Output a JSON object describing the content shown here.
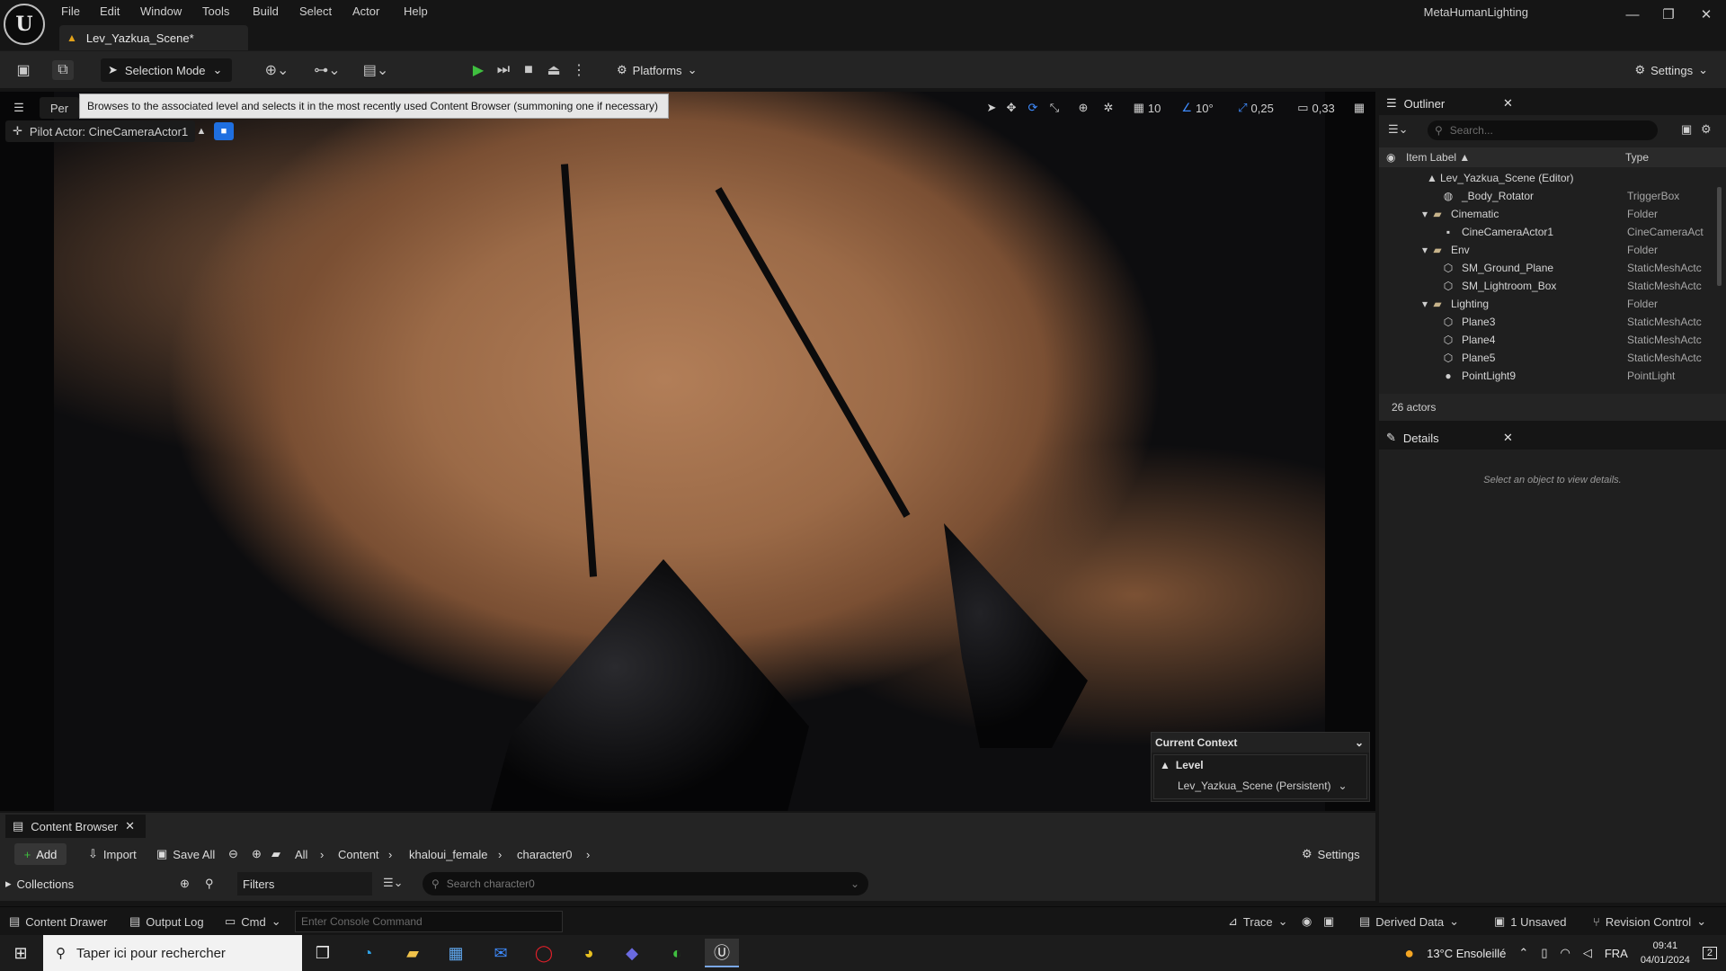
{
  "title_bar": {
    "logo": "U",
    "menu": [
      "File",
      "Edit",
      "Window",
      "Tools",
      "Build",
      "Select",
      "Actor",
      "Help"
    ],
    "app_title": "MetaHumanLighting",
    "window_buttons": {
      "minimize": "—",
      "restore": "❐",
      "close": "✕"
    }
  },
  "document_tab": {
    "label": "Lev_Yazkua_Scene*"
  },
  "toolbar": {
    "selection_mode": "Selection Mode",
    "platforms": "Platforms",
    "settings": "Settings"
  },
  "viewport": {
    "menu_short": "Per",
    "tooltip": "Browses to the associated level and selects it in the most recently used Content Browser (summoning one if necessary)",
    "pilot_actor": "Pilot Actor: CineCameraActor1",
    "grid_snap": "10",
    "rotation_snap": "10°",
    "scale_snap": "0,25",
    "camera_speed": "0,33",
    "context": {
      "header": "Current Context",
      "level_label": "Level",
      "level_value": "Lev_Yazkua_Scene (Persistent)"
    }
  },
  "outliner": {
    "tab": "Outliner",
    "search_placeholder": "Search...",
    "col_label": "Item Label ▲",
    "col_type": "Type",
    "rows": [
      {
        "label": "Lev_Yazkua_Scene (Editor)",
        "type": ""
      },
      {
        "label": "_Body_Rotator",
        "type": "TriggerBox"
      },
      {
        "label": "Cinematic",
        "type": "Folder"
      },
      {
        "label": "CineCameraActor1",
        "type": "CineCameraAct"
      },
      {
        "label": "Env",
        "type": "Folder"
      },
      {
        "label": "SM_Ground_Plane",
        "type": "StaticMeshActc"
      },
      {
        "label": "SM_Lightroom_Box",
        "type": "StaticMeshActc"
      },
      {
        "label": "Lighting",
        "type": "Folder"
      },
      {
        "label": "Plane3",
        "type": "StaticMeshActc"
      },
      {
        "label": "Plane4",
        "type": "StaticMeshActc"
      },
      {
        "label": "Plane5",
        "type": "StaticMeshActc"
      },
      {
        "label": "PointLight9",
        "type": "PointLight"
      }
    ],
    "actor_count": "26 actors"
  },
  "details": {
    "tab": "Details",
    "empty_text": "Select an object to view details."
  },
  "content_browser": {
    "tab": "Content Browser",
    "add": "Add",
    "import": "Import",
    "save_all": "Save All",
    "breadcrumb": [
      "All",
      "Content",
      "khaloui_female",
      "character0"
    ],
    "settings": "Settings",
    "collections": "Collections",
    "filters": "Filters",
    "search_placeholder": "Search character0"
  },
  "status_bar": {
    "content_drawer": "Content Drawer",
    "output_log": "Output Log",
    "cmd": "Cmd",
    "console_placeholder": "Enter Console Command",
    "trace": "Trace",
    "derived_data": "Derived Data",
    "unsaved": "1 Unsaved",
    "revision_control": "Revision Control"
  },
  "taskbar": {
    "search_placeholder": "Taper ici pour rechercher",
    "weather": "13°C Ensoleillé",
    "language": "FRA",
    "time": "09:41",
    "date": "04/01/2024",
    "notification_count": "2"
  }
}
